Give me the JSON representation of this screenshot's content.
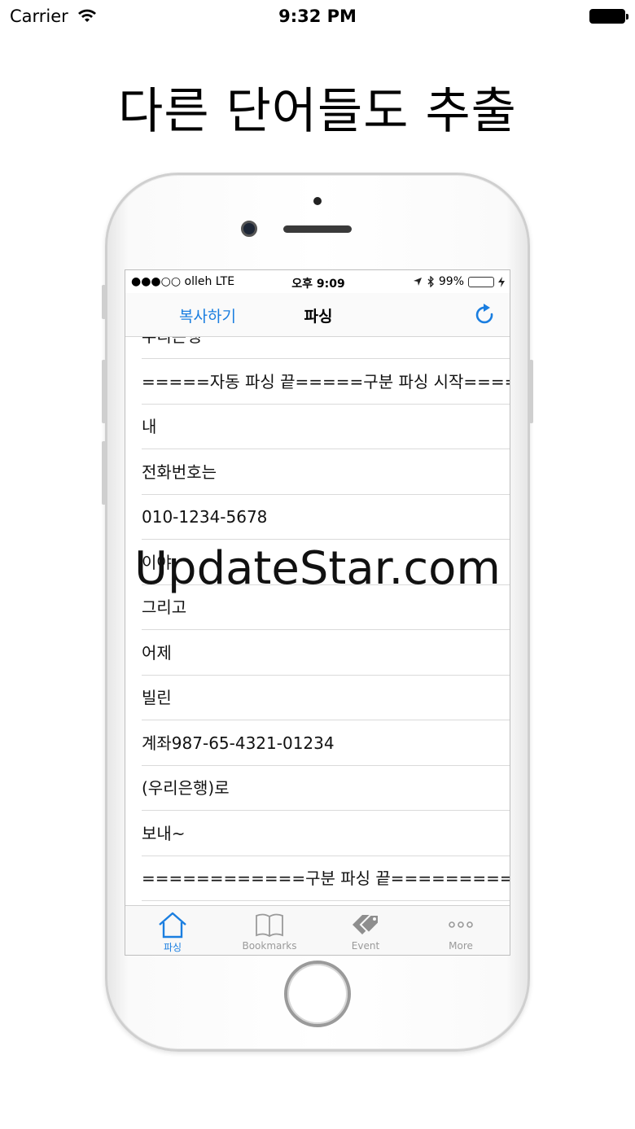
{
  "device_status": {
    "carrier": "Carrier",
    "time": "9:32 PM"
  },
  "headline": "다른 단어들도 추출",
  "app": {
    "status": {
      "carrier": "●●●○○ olleh   LTE",
      "time": "오후 9:09",
      "battery": "99%",
      "battery_level": 0.99
    },
    "navbar": {
      "left_button": "복사하기",
      "title": "파싱",
      "refresh_icon": "refresh-icon"
    },
    "list_items": [
      "우리은행",
      "=====자동 파싱 끝=====구분 파싱 시작=====",
      "내",
      "전화번호는",
      "010-1234-5678",
      "이야.",
      "그리고",
      "어제",
      "빌린",
      "계좌987-65-4321-01234",
      "(우리은행)로",
      "보내~",
      "============구분 파싱 끝============"
    ],
    "tabs": [
      {
        "label": "파싱",
        "icon": "home-icon",
        "active": true
      },
      {
        "label": "Bookmarks",
        "icon": "book-icon",
        "active": false
      },
      {
        "label": "Event",
        "icon": "tags-icon",
        "active": false
      },
      {
        "label": "More",
        "icon": "more-icon",
        "active": false
      }
    ]
  },
  "watermark": "UpdateStar.com",
  "colors": {
    "accent": "#1a7ee0",
    "battery_green": "#4cd964",
    "inactive": "#9a9a9a"
  }
}
